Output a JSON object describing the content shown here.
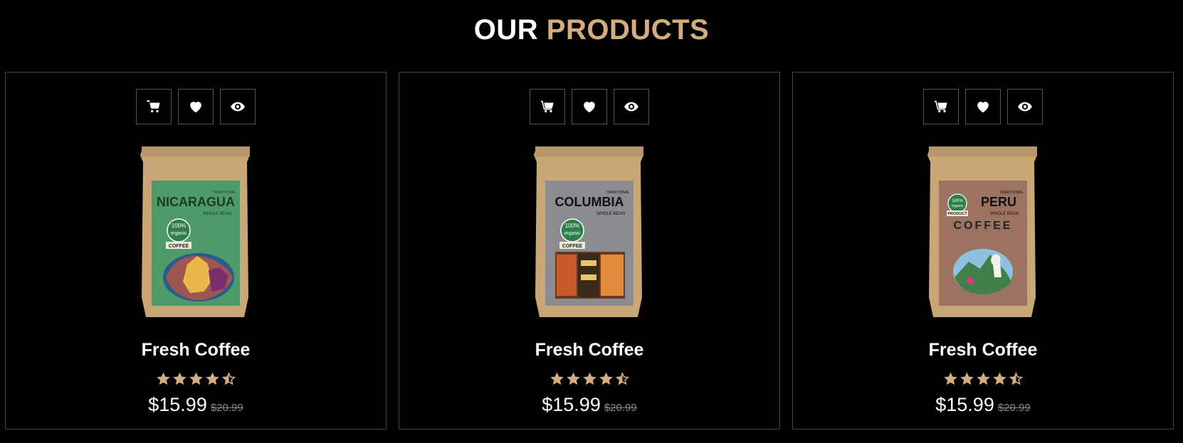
{
  "heading": {
    "prefix": "OUR",
    "accent": "PRODUCTS"
  },
  "colors": {
    "accent": "#d3ad7f",
    "background": "#000000",
    "border": "#444444"
  },
  "products": [
    {
      "title": "Fresh Coffee",
      "price": "$15.99",
      "old_price": "$20.99",
      "rating": 4.5,
      "actions": [
        "cart-icon",
        "heart-icon",
        "eye-icon"
      ],
      "image": {
        "label_top": "TRADITIONAL",
        "origin": "NICARAGUA",
        "sub": "WHOLE BEAN",
        "badge": [
          "100%",
          "organic",
          "COFFEE"
        ],
        "label_color": "#4f9a6b"
      }
    },
    {
      "title": "Fresh Coffee",
      "price": "$15.99",
      "old_price": "$20.99",
      "rating": 4.5,
      "actions": [
        "cart-icon",
        "heart-icon",
        "eye-icon"
      ],
      "image": {
        "label_top": "TRADITIONAL",
        "origin": "COLUMBIA",
        "sub": "WHOLE BEAN",
        "badge": [
          "100%",
          "organic",
          "COFFEE"
        ],
        "label_color": "#8a8c8f"
      }
    },
    {
      "title": "Fresh Coffee",
      "price": "$15.99",
      "old_price": "$20.99",
      "rating": 4.5,
      "actions": [
        "cart-icon",
        "heart-icon",
        "eye-icon"
      ],
      "image": {
        "label_top": "TRADITIONAL",
        "origin": "PERU",
        "sub": "WHOLE BEAN",
        "badge": [
          "100%",
          "organic",
          "PRODUCT"
        ],
        "title2": "COFFEE",
        "label_color": "#9c7360"
      }
    }
  ]
}
